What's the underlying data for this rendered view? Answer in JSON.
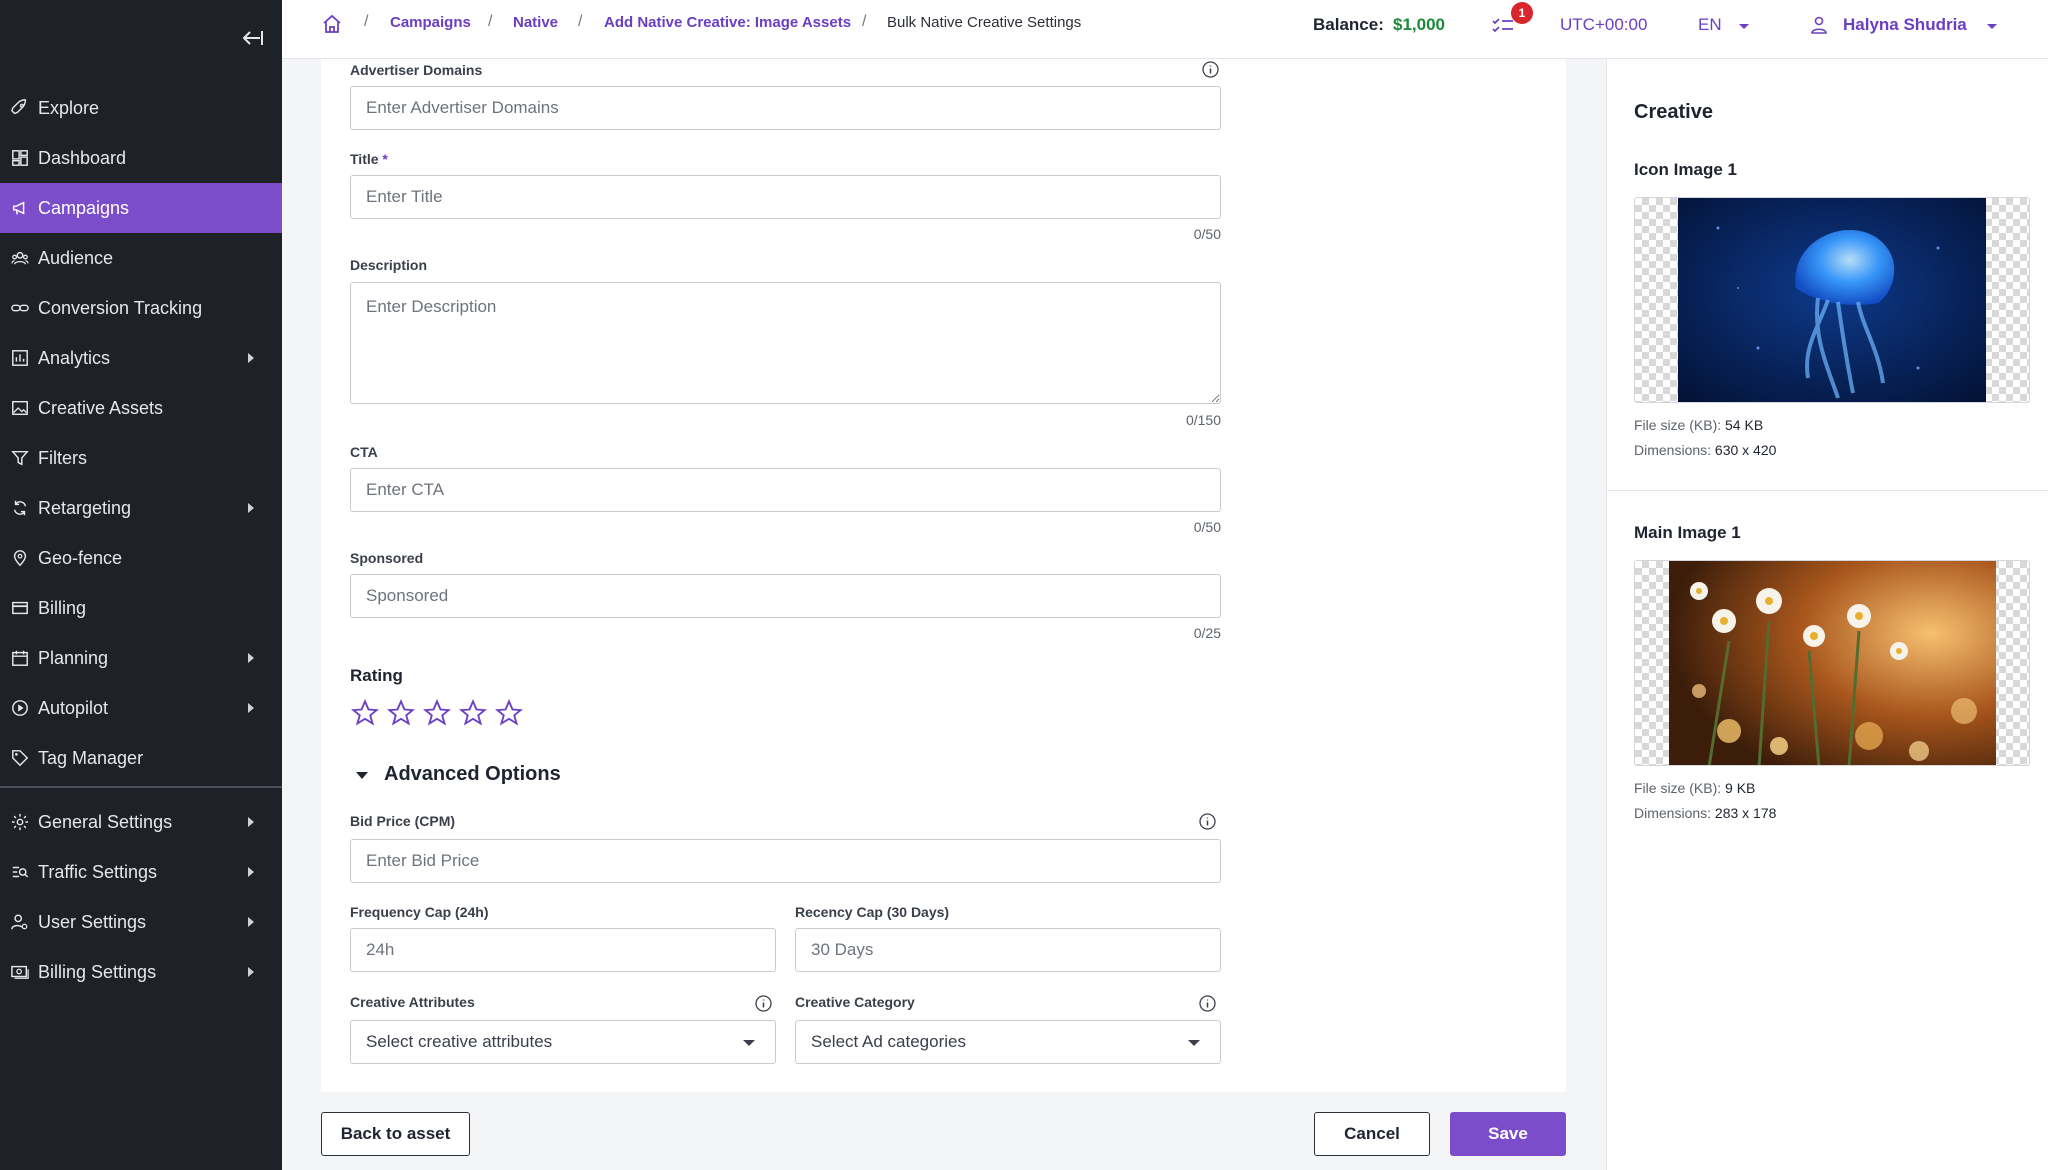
{
  "sidebar": {
    "items": [
      {
        "label": "Explore",
        "icon": "rocket-icon",
        "has_submenu": false
      },
      {
        "label": "Dashboard",
        "icon": "dashboard-icon",
        "has_submenu": false
      },
      {
        "label": "Campaigns",
        "icon": "megaphone-icon",
        "has_submenu": false,
        "active": true
      },
      {
        "label": "Audience",
        "icon": "people-icon",
        "has_submenu": false
      },
      {
        "label": "Conversion Tracking",
        "icon": "link-icon",
        "has_submenu": false
      },
      {
        "label": "Analytics",
        "icon": "bar-chart-icon",
        "has_submenu": true
      },
      {
        "label": "Creative Assets",
        "icon": "image-icon",
        "has_submenu": false
      },
      {
        "label": "Filters",
        "icon": "funnel-icon",
        "has_submenu": false
      },
      {
        "label": "Retargeting",
        "icon": "refresh-icon",
        "has_submenu": true
      },
      {
        "label": "Geo-fence",
        "icon": "map-pin-icon",
        "has_submenu": false
      },
      {
        "label": "Billing",
        "icon": "credit-card-icon",
        "has_submenu": false
      },
      {
        "label": "Planning",
        "icon": "calendar-icon",
        "has_submenu": true
      },
      {
        "label": "Autopilot",
        "icon": "play-circle-icon",
        "has_submenu": true
      },
      {
        "label": "Tag Manager",
        "icon": "tag-icon",
        "has_submenu": false
      }
    ],
    "settings_items": [
      {
        "label": "General Settings",
        "icon": "gear-icon"
      },
      {
        "label": "Traffic Settings",
        "icon": "list-search-icon"
      },
      {
        "label": "User Settings",
        "icon": "user-gear-icon"
      },
      {
        "label": "Billing Settings",
        "icon": "money-icon"
      }
    ]
  },
  "breadcrumb": {
    "items": [
      "Campaigns",
      "Native",
      "Add Native Creative: Image Assets"
    ],
    "current": "Bulk Native Creative Settings",
    "separator": "/"
  },
  "header": {
    "balance_label": "Balance:",
    "balance_value": "$1,000",
    "notification_count": "1",
    "timezone": "UTC+00:00",
    "language": "EN",
    "user_name": "Halyna Shudria"
  },
  "form": {
    "advertiser_domains": {
      "label": "Advertiser Domains",
      "placeholder": "Enter Advertiser Domains",
      "value": ""
    },
    "title": {
      "label": "Title",
      "required_mark": "*",
      "placeholder": "Enter Title",
      "value": "",
      "counter": "0/50"
    },
    "description": {
      "label": "Description",
      "placeholder": "Enter Description",
      "value": "",
      "counter": "0/150"
    },
    "cta": {
      "label": "CTA",
      "placeholder": "Enter CTA",
      "value": "",
      "counter": "0/50"
    },
    "sponsored": {
      "label": "Sponsored",
      "placeholder": "Sponsored",
      "value": "",
      "counter": "0/25"
    },
    "rating": {
      "label": "Rating",
      "max": 5,
      "value": 0
    },
    "advanced_title": "Advanced Options",
    "bid_price": {
      "label": "Bid Price (CPM)",
      "placeholder": "Enter Bid Price",
      "value": ""
    },
    "frequency_cap": {
      "label": "Frequency Cap (24h)",
      "placeholder": "24h",
      "value": ""
    },
    "recency_cap": {
      "label": "Recency Cap (30 Days)",
      "placeholder": "30 Days",
      "value": ""
    },
    "creative_attributes": {
      "label": "Creative Attributes",
      "selected": "Select creative attributes"
    },
    "creative_category": {
      "label": "Creative Category",
      "selected": "Select Ad categories"
    }
  },
  "footer": {
    "back_label": "Back to asset",
    "cancel_label": "Cancel",
    "save_label": "Save"
  },
  "preview": {
    "title": "Creative",
    "icon_image": {
      "label": "Icon Image 1",
      "file_size_label": "File size (KB):",
      "file_size": "54 KB",
      "dimensions_label": "Dimensions:",
      "dimensions": "630 x 420"
    },
    "main_image": {
      "label": "Main Image 1",
      "file_size_label": "File size (KB):",
      "file_size": "9 KB",
      "dimensions_label": "Dimensions:",
      "dimensions": "283 x 178"
    }
  },
  "colors": {
    "accent": "#7c4dcb",
    "sidebar_bg": "#1f2128",
    "balance": "#1a8a3a",
    "badge": "#d9262c"
  }
}
